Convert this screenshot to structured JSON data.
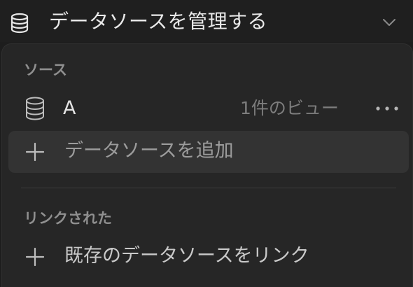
{
  "header": {
    "title": "データソースを管理する",
    "icon": "database-icon",
    "chevron_icon": "chevron-down-icon"
  },
  "sources_section": {
    "label": "ソース",
    "items": [
      {
        "name": "A",
        "meta": "1件のビュー",
        "icon": "database-icon",
        "menu_icon": "more-horizontal-icon"
      }
    ],
    "add_label": "データソースを追加"
  },
  "linked_section": {
    "label": "リンクされた",
    "link_label": "既存のデータソースをリンク"
  },
  "colors": {
    "background": "#1d1d1d",
    "panel": "#262626",
    "hover_row": "#333333",
    "text_primary": "#e4e4e4",
    "text_secondary": "#8f8f8f"
  }
}
